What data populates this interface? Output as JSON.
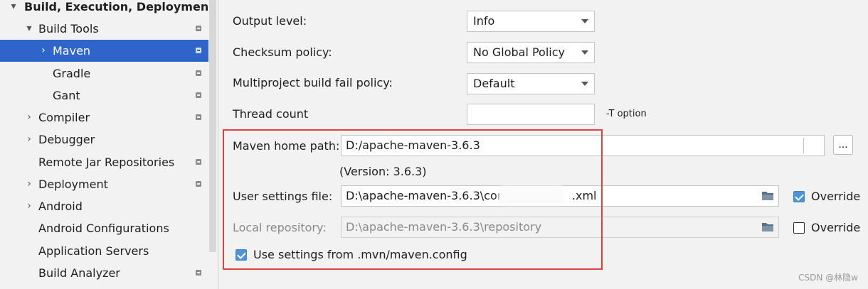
{
  "sidebar": {
    "items": [
      {
        "label": "Build, Execution, Deployment",
        "arrow": "▾",
        "project_icon": false,
        "selected": false
      },
      {
        "label": "Build Tools",
        "arrow": "▾",
        "project_icon": true,
        "selected": false
      },
      {
        "label": "Maven",
        "arrow": "›",
        "project_icon": true,
        "selected": true
      },
      {
        "label": "Gradle",
        "arrow": "",
        "project_icon": true,
        "selected": false
      },
      {
        "label": "Gant",
        "arrow": "",
        "project_icon": true,
        "selected": false
      },
      {
        "label": "Compiler",
        "arrow": "›",
        "project_icon": true,
        "selected": false
      },
      {
        "label": "Debugger",
        "arrow": "›",
        "project_icon": false,
        "selected": false
      },
      {
        "label": "Remote Jar Repositories",
        "arrow": "",
        "project_icon": true,
        "selected": false
      },
      {
        "label": "Deployment",
        "arrow": "›",
        "project_icon": true,
        "selected": false
      },
      {
        "label": "Android",
        "arrow": "›",
        "project_icon": false,
        "selected": false
      },
      {
        "label": "Android Configurations",
        "arrow": "",
        "project_icon": false,
        "selected": false
      },
      {
        "label": "Application Servers",
        "arrow": "",
        "project_icon": false,
        "selected": false
      },
      {
        "label": "Build Analyzer",
        "arrow": "",
        "project_icon": true,
        "selected": false
      }
    ]
  },
  "form": {
    "output_level": {
      "label": "Output level:",
      "value": "Info"
    },
    "checksum_policy": {
      "label": "Checksum policy:",
      "value": "No Global Policy"
    },
    "fail_policy": {
      "label": "Multiproject build fail policy:",
      "value": "Default"
    },
    "thread_count": {
      "label": "Thread count",
      "value": "",
      "hint": "-T option"
    },
    "maven_home": {
      "label": "Maven home path:",
      "value": "D:/apache-maven-3.6.3",
      "browse_label": "...",
      "version": "(Version: 3.6.3)"
    },
    "user_settings": {
      "label": "User settings file:",
      "value": "D:\\apache-maven-3.6.3\\conf\\",
      "value_suffix": ".xml",
      "override_label": "Override",
      "override_checked": true
    },
    "local_repo": {
      "label": "Local repository:",
      "value": "D:\\apache-maven-3.6.3\\repository",
      "override_label": "Override",
      "override_checked": false
    },
    "mvn_config": {
      "label": "Use settings from .mvn/maven.config",
      "checked": true
    }
  },
  "colors": {
    "selection": "#2f65ca",
    "highlight_box": "#e34040",
    "checkbox": "#4b95d6"
  },
  "watermark": "CSDN @林隐w"
}
